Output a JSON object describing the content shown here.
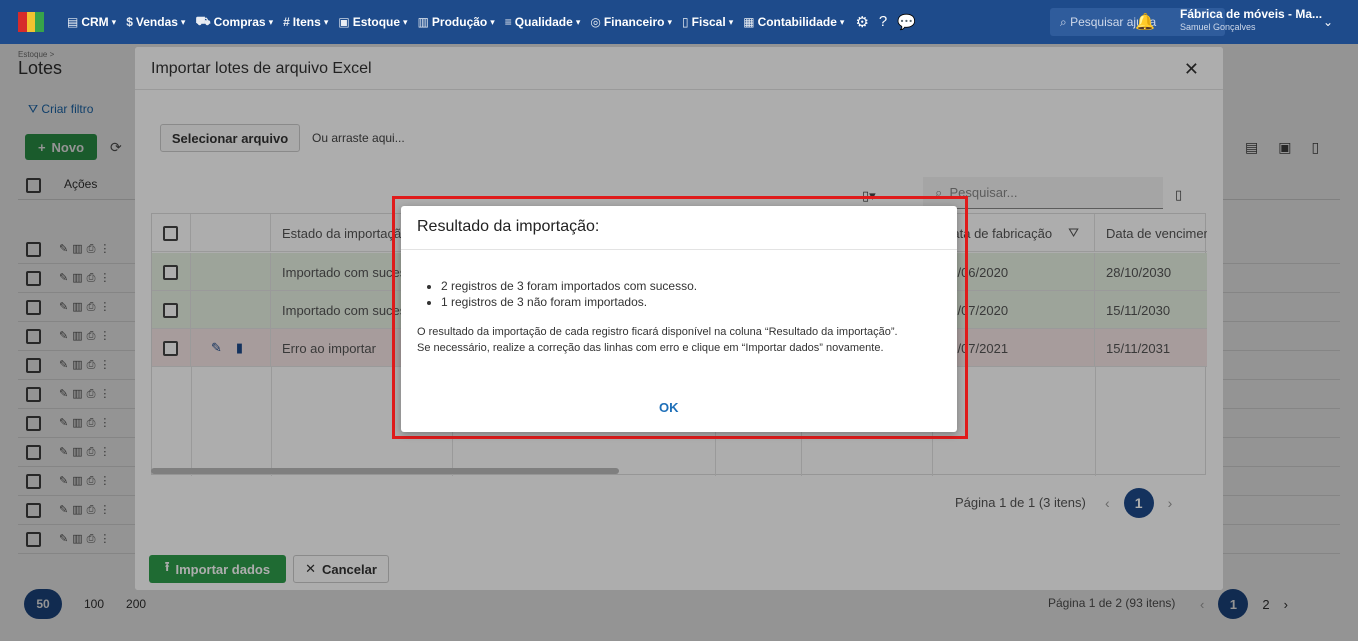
{
  "topbar": {
    "menu": [
      {
        "icon": "crm-icon",
        "glyph": "▤",
        "label": "CRM"
      },
      {
        "icon": "dollar-icon",
        "glyph": "$",
        "label": "Vendas"
      },
      {
        "icon": "cart-icon",
        "glyph": "⛟",
        "label": "Compras"
      },
      {
        "icon": "tag-icon",
        "glyph": "#",
        "label": "Itens"
      },
      {
        "icon": "box-icon",
        "glyph": "▣",
        "label": "Estoque"
      },
      {
        "icon": "factory-icon",
        "glyph": "▥",
        "label": "Produção"
      },
      {
        "icon": "checklist-icon",
        "glyph": "≡",
        "label": "Qualidade"
      },
      {
        "icon": "money-icon",
        "glyph": "◎",
        "label": "Financeiro"
      },
      {
        "icon": "receipt-icon",
        "glyph": "▯",
        "label": "Fiscal"
      },
      {
        "icon": "ledger-icon",
        "glyph": "▦",
        "label": "Contabilidade"
      }
    ],
    "search_placeholder": "Pesquisar ajuda",
    "company_name": "Fábrica de móveis - Ma...",
    "user_name": "Samuel Gonçalves"
  },
  "page": {
    "breadcrumb": "Estoque >",
    "title": "Lotes",
    "create_filter": "Criar filtro",
    "new_button": "Novo",
    "actions_header": "Ações",
    "page_sizes": [
      "50",
      "100",
      "200"
    ],
    "page_info": "Página 1 de 2 (93 itens)",
    "pages": [
      "1",
      "2"
    ]
  },
  "import_modal": {
    "title": "Importar lotes de arquivo Excel",
    "select_file": "Selecionar arquivo",
    "drop_hint": "Ou arraste aqui...",
    "search_placeholder": "Pesquisar...",
    "columns": {
      "status": "Estado da importação",
      "manufacture_date": "Data de fabricação",
      "expiry_date": "Data de vencimento"
    },
    "rows": [
      {
        "status": "Importado com sucesso",
        "manufacture": "21/06/2020",
        "expiry": "28/10/2030",
        "state": "success"
      },
      {
        "status": "Importado com sucesso",
        "manufacture": "15/07/2020",
        "expiry": "15/11/2030",
        "state": "success"
      },
      {
        "status": "Erro ao importar",
        "manufacture": "15/07/2021",
        "expiry": "15/11/2031",
        "state": "error"
      }
    ],
    "page_info": "Página 1 de 1 (3 itens)",
    "current_page": "1",
    "import_button": "Importar dados",
    "cancel_button": "Cancelar"
  },
  "result_dialog": {
    "title": "Resultado da importação:",
    "items": [
      "2 registros de 3 foram importados com sucesso.",
      "1 registros de 3 não foram importados."
    ],
    "note_line1": "O resultado da importação de cada registro ficará disponível na coluna “Resultado da importação”.",
    "note_line2": "Se necessário, realize a correção das linhas com erro e clique em “Importar dados” novamente.",
    "ok_button": "OK"
  },
  "colors": {
    "topbar": "#1e4b8b",
    "primary": "#1e6fb8",
    "success": "#2e9e4c",
    "success_row": "#e7f2e4",
    "error_row": "#f6e6e6",
    "highlight": "#e01b1b"
  }
}
